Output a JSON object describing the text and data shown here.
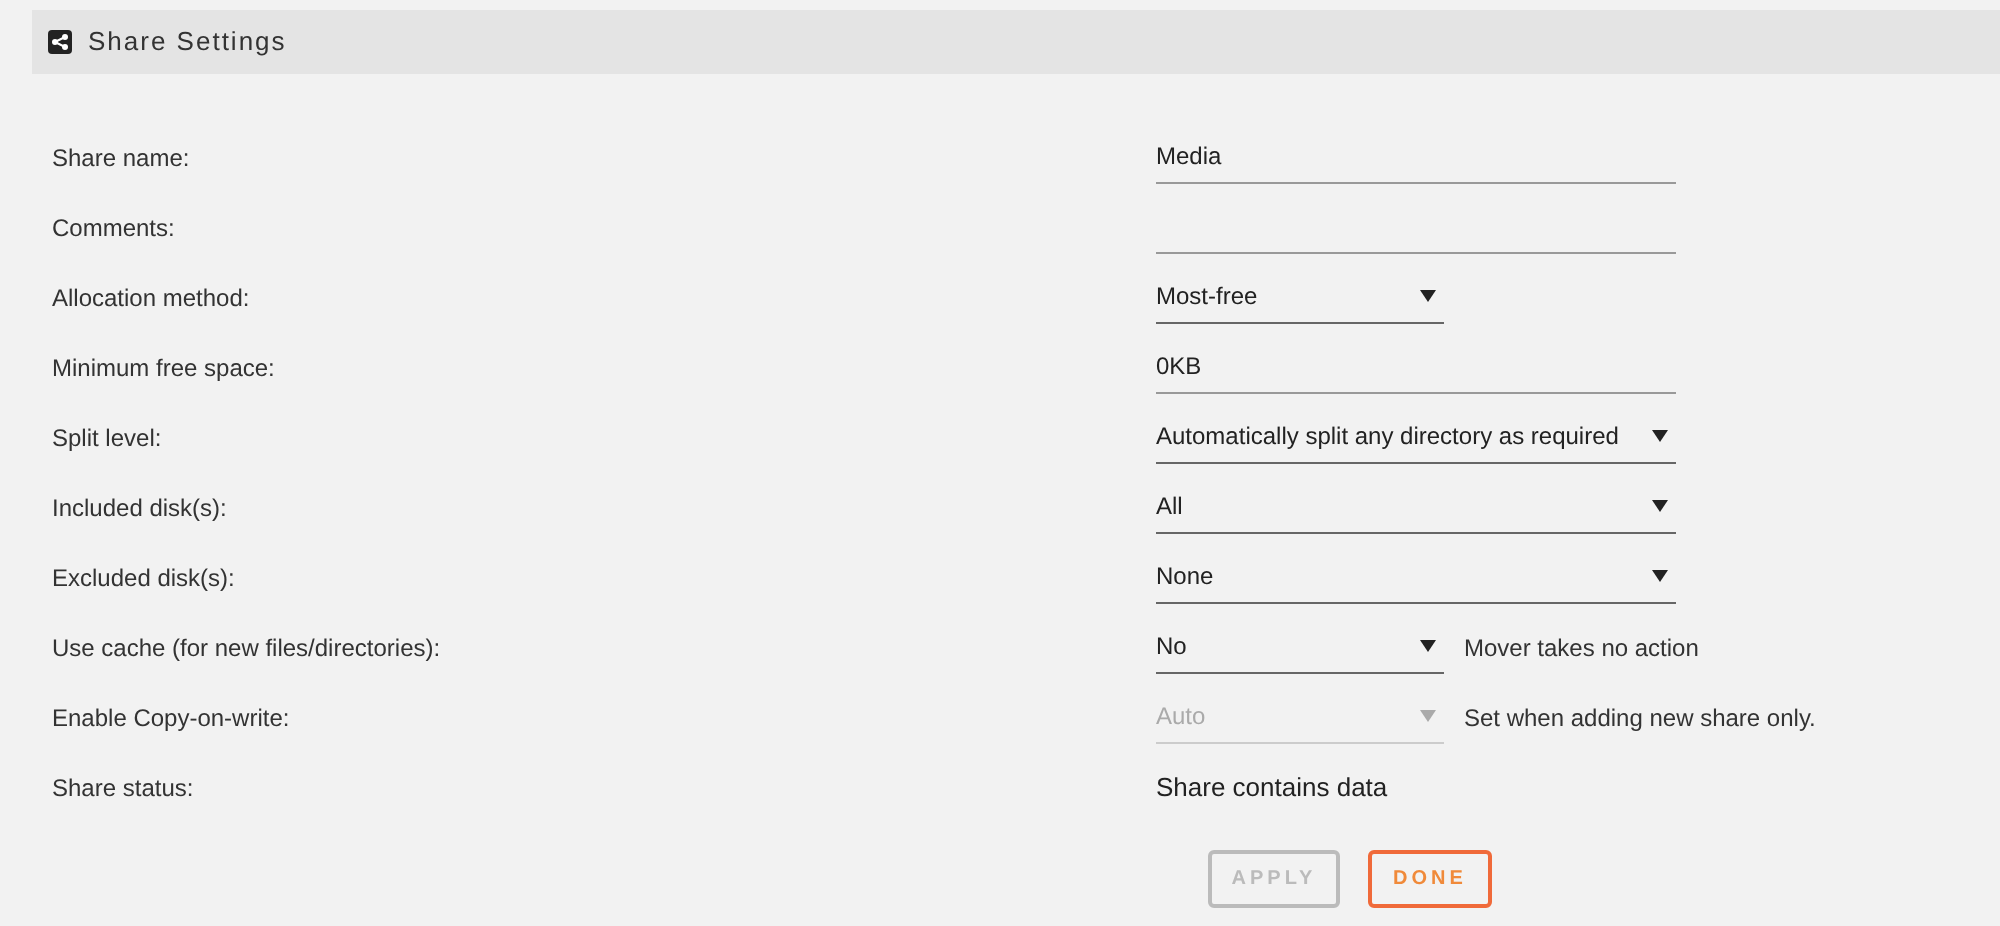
{
  "header": {
    "title": "Share Settings"
  },
  "rows": [
    {
      "label": "Share name:",
      "kind": "text",
      "value": "Media",
      "wide": true
    },
    {
      "label": "Comments:",
      "kind": "text",
      "wide": true
    },
    {
      "label": "Allocation method:",
      "kind": "select",
      "value": "Most-free",
      "wide": false,
      "disabled": false
    },
    {
      "label": "Minimum free space:",
      "kind": "text",
      "value": "0KB",
      "wide": true
    },
    {
      "label": "Split level:",
      "kind": "select",
      "value": "Automatically split any directory as required",
      "wide": true,
      "disabled": false
    },
    {
      "label": "Included disk(s):",
      "kind": "select",
      "value": "All",
      "wide": true,
      "disabled": false
    },
    {
      "label": "Excluded disk(s):",
      "kind": "select",
      "value": "None",
      "wide": true,
      "disabled": false
    },
    {
      "label": "Use cache (for new files/directories):",
      "kind": "select",
      "value": "No",
      "wide": false,
      "disabled": false,
      "note": "Mover takes no action"
    },
    {
      "label": "Enable Copy-on-write:",
      "kind": "select",
      "value": "Auto",
      "wide": false,
      "disabled": true,
      "note": "Set when adding new share only."
    },
    {
      "label": "Share status:",
      "kind": "static",
      "value": "Share contains data"
    }
  ],
  "buttons": [
    {
      "label": "APPLY",
      "disabled": true,
      "kind": "plain"
    },
    {
      "label": "DONE",
      "disabled": false,
      "kind": "accent"
    }
  ]
}
